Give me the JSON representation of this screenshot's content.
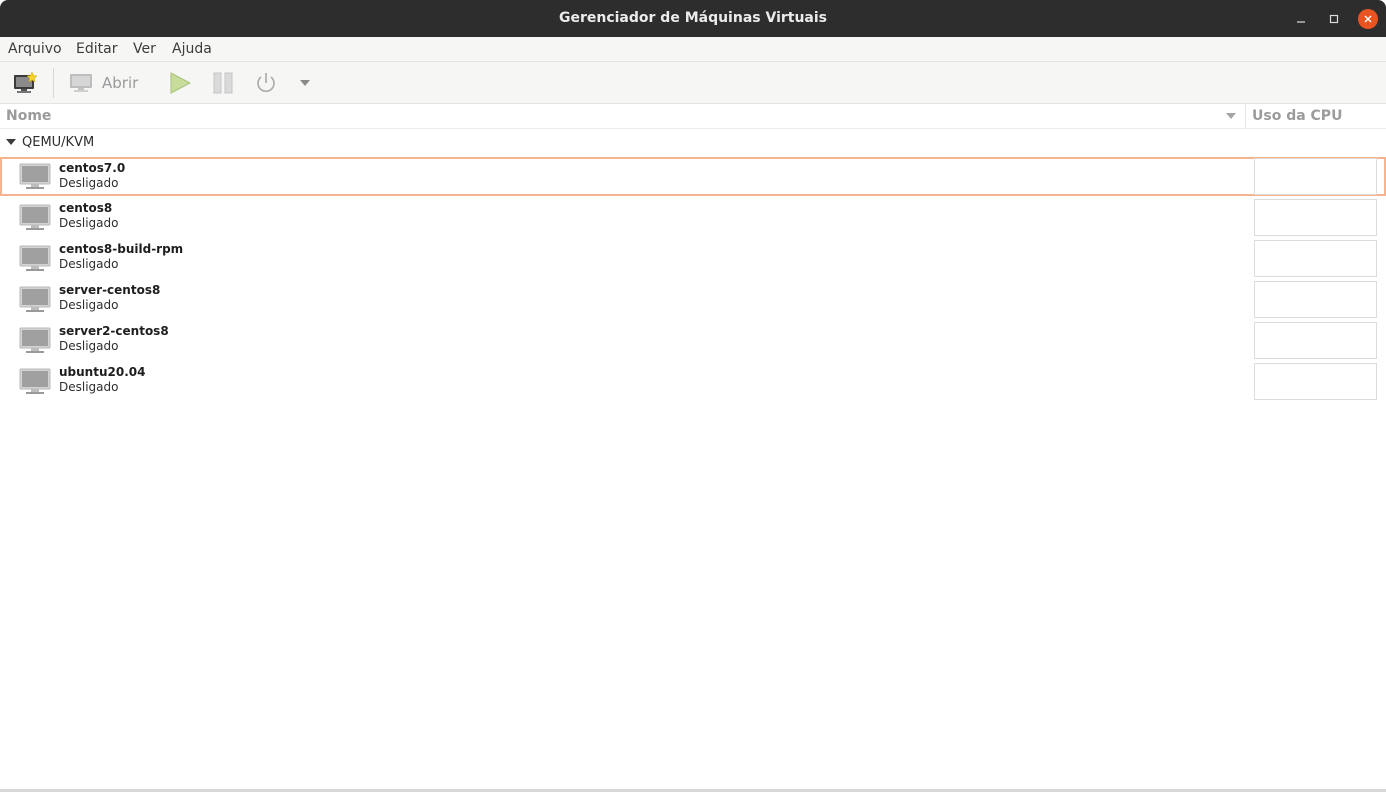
{
  "window": {
    "title": "Gerenciador de Máquinas Virtuais"
  },
  "menu": {
    "items": [
      "Arquivo",
      "Editar",
      "Ver",
      "Ajuda"
    ]
  },
  "toolbar": {
    "new_vm_icon": "new-vm-icon",
    "open_label": "Abrir",
    "run_icon": "play-icon",
    "pause_icon": "pause-icon",
    "shutdown_icon": "power-icon",
    "shutdown_menu_icon": "chevron-down-icon"
  },
  "columns": {
    "name": "Nome",
    "cpu": "Uso da CPU"
  },
  "group": {
    "label": "QEMU/KVM"
  },
  "vms": [
    {
      "name": "centos7.0",
      "status": "Desligado",
      "selected": true
    },
    {
      "name": "centos8",
      "status": "Desligado",
      "selected": false
    },
    {
      "name": "centos8-build-rpm",
      "status": "Desligado",
      "selected": false
    },
    {
      "name": "server-centos8",
      "status": "Desligado",
      "selected": false
    },
    {
      "name": "server2-centos8",
      "status": "Desligado",
      "selected": false
    },
    {
      "name": "ubuntu20.04",
      "status": "Desligado",
      "selected": false
    }
  ],
  "colors": {
    "accent": "#e95420",
    "selection_border": "#f3b48f",
    "titlebar": "#2d2d2d"
  }
}
